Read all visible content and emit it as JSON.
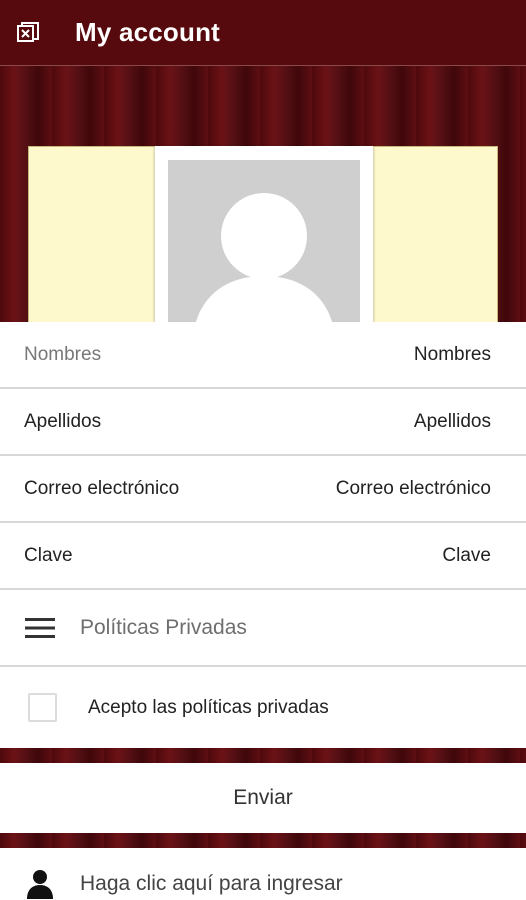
{
  "header": {
    "title": "My account",
    "close_icon": "close-window-icon"
  },
  "colors": {
    "brand": "#560a0d",
    "cream": "#fdf9cc"
  },
  "form": {
    "fields": [
      {
        "label": "Nombres",
        "value": "Nombres"
      },
      {
        "label": "Apellidos",
        "value": "Apellidos"
      },
      {
        "label": "Correo electrónico",
        "value": "Correo electrónico"
      },
      {
        "label": "Clave",
        "value": "Clave"
      }
    ],
    "policies_label": "Políticas Privadas",
    "accept_label": "Acepto las políticas privadas",
    "accept_checked": false,
    "submit_label": "Enviar",
    "login_link": "Haga clic aquí para ingresar"
  }
}
